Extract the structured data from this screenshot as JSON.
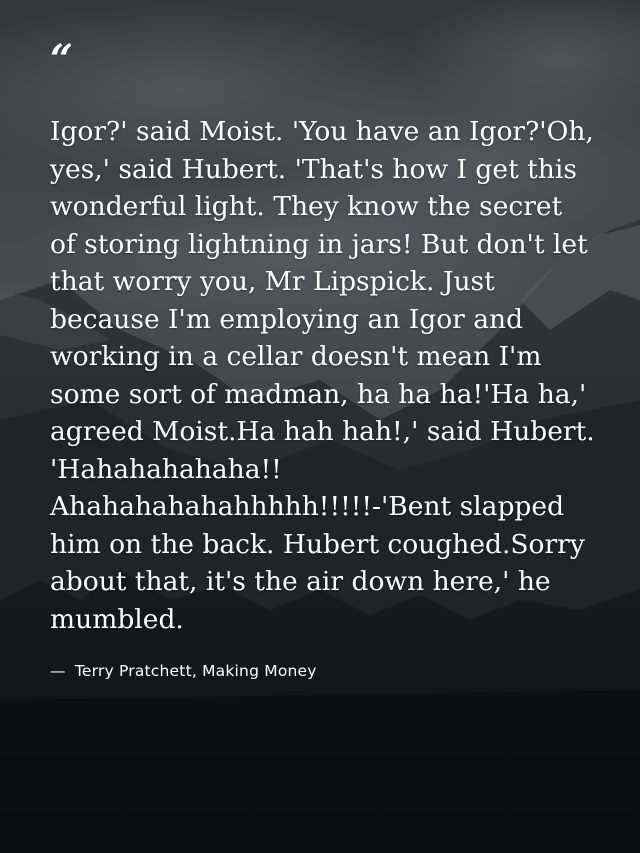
{
  "quote": {
    "mark": "“",
    "text": "Igor?' said Moist. 'You have an Igor?'Oh, yes,' said Hubert. 'That's how I get this wonderful light. They know the secret of storing lightning in jars! But don't let that worry you, Mr Lipspick. Just because I'm employing an Igor and working in a cellar doesn't mean I'm some sort of madman, ha ha ha!'Ha ha,' agreed Moist.Ha hah hah!,' said Hubert. 'Hahahahahaha!! Ahahahahahahhhhh!!!!!-'Bent slapped him on the back. Hubert coughed.Sorry about that, it's the air down here,' he mumbled.",
    "dash": "—",
    "author": "Terry Pratchett, Making Money"
  },
  "colors": {
    "text": "#ffffff",
    "sky": "#6e7680",
    "mountain": "#2a2e33",
    "forest": "#14181b"
  }
}
